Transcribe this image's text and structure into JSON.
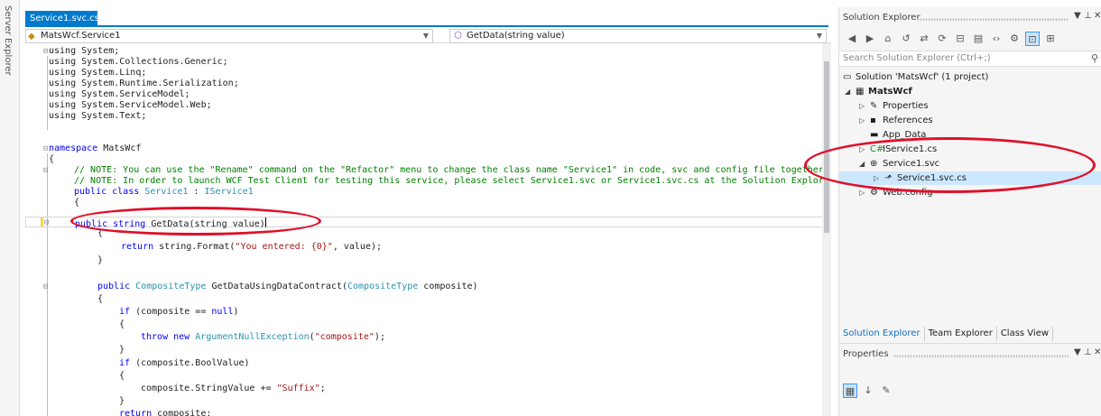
{
  "server_explorer": {
    "label": "Server Explorer"
  },
  "document_tab": {
    "title": "Service1.svc.cs*",
    "pin": "⊕",
    "close": "✕"
  },
  "navbar": {
    "left": "MatsWcf.Service1",
    "right": "GetData(string value)"
  },
  "code": {
    "l1": "using System;",
    "l2": "using System.Collections.Generic;",
    "l3": "using System.Linq;",
    "l4": "using System.Runtime.Serialization;",
    "l5": "using System.ServiceModel;",
    "l6": "using System.ServiceModel.Web;",
    "l7": "using System.Text;",
    "l8_kw": "namespace",
    "l8_name": "MatsWcf",
    "l9": "{",
    "l10": "// NOTE: You can use the \"Rename\" command on the \"Refactor\" menu to change the class name \"Service1\" in code, svc and config file together",
    "l11": "// NOTE: In order to launch WCF Test Client for testing this service, please select Service1.svc or Service1.svc.cs at the Solution Explor",
    "l12_kw": "public class",
    "l12_name": "Service1",
    "l12_base": "IService1",
    "l13": "{",
    "l14_kw": "public string",
    "l14_rest": "GetData(string value)",
    "l15": "{",
    "l16_kw": "return",
    "l16_a": "string.Format(",
    "l16_str": "\"You entered: {0}\"",
    "l16_b": ", value);",
    "l17": "}",
    "l18_kw": "public",
    "l18_ty": "CompositeType",
    "l18_mid": "GetDataUsingDataContract(",
    "l18_ty2": "CompositeType",
    "l18_end": "composite)",
    "l19": "{",
    "l20_kw": "if",
    "l20_a": "(composite ==",
    "l20_null": "null",
    "l20_b": ")",
    "l21": "{",
    "l22_kw": "throw new",
    "l22_ty": "ArgumentNullException",
    "l22_a": "(",
    "l22_str": "\"composite\"",
    "l22_b": ");",
    "l23": "}",
    "l24_kw": "if",
    "l24_a": "(composite.BoolValue)",
    "l25": "{",
    "l26_a": "composite.StringValue +=",
    "l26_str": "\"Suffix\"",
    "l26_b": ";",
    "l27": "}",
    "l28_kw": "return",
    "l28_a": "composite;"
  },
  "solution_explorer": {
    "title": "Solution Explorer",
    "search_placeholder": "Search Solution Explorer (Ctrl+;)",
    "items": [
      {
        "label": "Solution 'MatsWcf' (1 project)"
      },
      {
        "label": "MatsWcf"
      },
      {
        "label": "Properties"
      },
      {
        "label": "References"
      },
      {
        "label": "App_Data"
      },
      {
        "label": "IService1.cs"
      },
      {
        "label": "Service1.svc"
      },
      {
        "label": "Service1.svc.cs"
      },
      {
        "label": "Web.config"
      }
    ],
    "tabs": [
      "Solution Explorer",
      "Team Explorer",
      "Class View"
    ]
  },
  "properties": {
    "title": "Properties"
  },
  "colors": {
    "accent": "#007acc",
    "annotation": "#e0102a",
    "selected": "#cce8ff"
  }
}
